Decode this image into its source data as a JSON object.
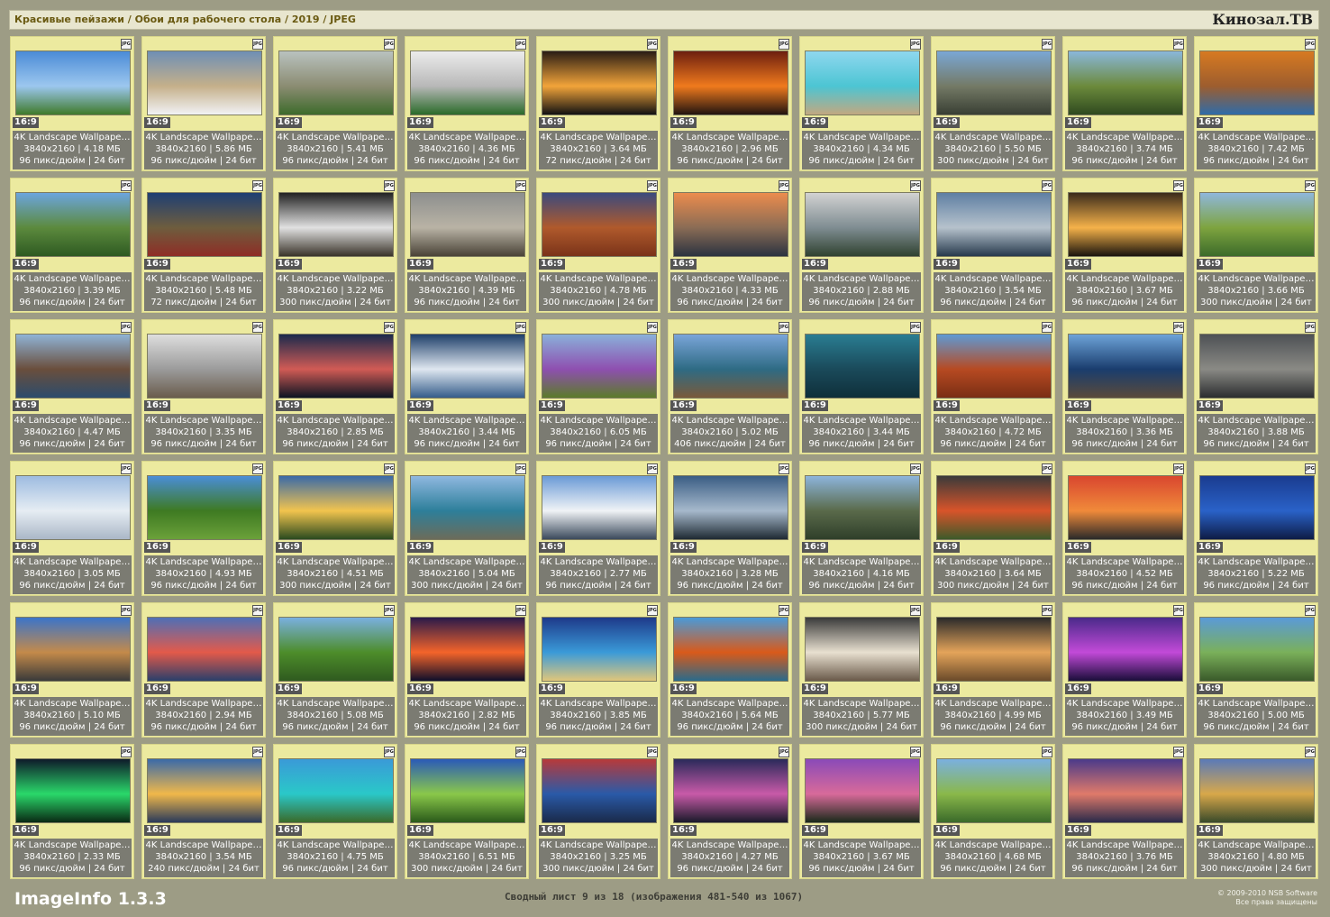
{
  "header": {
    "path": "Красивые пейзажи / Обои для рабочего стола / 2019 / JPEG",
    "brand": "Кинозал.ТВ"
  },
  "common": {
    "badge": "JPG",
    "ratio": "16:9",
    "name": "4K Landscape Wallpape…",
    "resolution": "3840x2160",
    "bit_depth": "24 бит"
  },
  "items": [
    {
      "size": "4.18 МБ",
      "dpi": "96 пикс/дюйм",
      "colors": [
        "#4b8bd6",
        "#9cc7ef",
        "#3f7a2a"
      ]
    },
    {
      "size": "5.86 МБ",
      "dpi": "96 пикс/дюйм",
      "colors": [
        "#6f8fb5",
        "#c5b08a",
        "#f1f2f5"
      ]
    },
    {
      "size": "5.41 МБ",
      "dpi": "96 пикс/дюйм",
      "colors": [
        "#b9c2bf",
        "#8b8c72",
        "#3d6b2b"
      ]
    },
    {
      "size": "4.36 МБ",
      "dpi": "96 пикс/дюйм",
      "colors": [
        "#ececec",
        "#b8b8b8",
        "#2b6b2a"
      ]
    },
    {
      "size": "3.64 МБ",
      "dpi": "72 пикс/дюйм",
      "colors": [
        "#2a1d14",
        "#f2a43a",
        "#121212"
      ]
    },
    {
      "size": "2.96 МБ",
      "dpi": "96 пикс/дюйм",
      "colors": [
        "#6d1f0f",
        "#f07a1d",
        "#211410"
      ]
    },
    {
      "size": "4.34 МБ",
      "dpi": "96 пикс/дюйм",
      "colors": [
        "#8fd7ef",
        "#4cc5d3",
        "#c2a880"
      ]
    },
    {
      "size": "5.50 МБ",
      "dpi": "300 пикс/дюйм",
      "colors": [
        "#7aa7d5",
        "#747a66",
        "#393f34"
      ]
    },
    {
      "size": "3.74 МБ",
      "dpi": "96 пикс/дюйм",
      "colors": [
        "#8ab7da",
        "#6c8a3c",
        "#2f4a1f"
      ]
    },
    {
      "size": "7.42 МБ",
      "dpi": "96 пикс/дюйм",
      "colors": [
        "#d77a21",
        "#9d5d2e",
        "#2f6ba8"
      ]
    },
    {
      "size": "3.39 МБ",
      "dpi": "96 пикс/дюйм",
      "colors": [
        "#6ca5de",
        "#5c8a3d",
        "#2e5a22"
      ]
    },
    {
      "size": "5.48 МБ",
      "dpi": "72 пикс/дюйм",
      "colors": [
        "#1f3f73",
        "#6e5d3e",
        "#8f2d26"
      ]
    },
    {
      "size": "3.22 МБ",
      "dpi": "300 пикс/дюйм",
      "colors": [
        "#222222",
        "#e1e1e1",
        "#3a342a"
      ]
    },
    {
      "size": "4.39 МБ",
      "dpi": "96 пикс/дюйм",
      "colors": [
        "#8d8f8e",
        "#b9b3a5",
        "#4a4337"
      ]
    },
    {
      "size": "4.78 МБ",
      "dpi": "300 пикс/дюйм",
      "colors": [
        "#3b4a7d",
        "#b05a2c",
        "#7a3319"
      ]
    },
    {
      "size": "4.33 МБ",
      "dpi": "96 пикс/дюйм",
      "colors": [
        "#ec8c4d",
        "#8a6c55",
        "#2b3340"
      ]
    },
    {
      "size": "2.88 МБ",
      "dpi": "96 пикс/дюйм",
      "colors": [
        "#d2d2d2",
        "#7f8d92",
        "#304230"
      ]
    },
    {
      "size": "3.54 МБ",
      "dpi": "96 пикс/дюйм",
      "colors": [
        "#5f7fa3",
        "#b6c2cc",
        "#273a4d"
      ]
    },
    {
      "size": "3.67 МБ",
      "dpi": "96 пикс/дюйм",
      "colors": [
        "#3b2b1b",
        "#f5b24a",
        "#1a140d"
      ]
    },
    {
      "size": "3.66 МБ",
      "dpi": "300 пикс/дюйм",
      "colors": [
        "#8fb7dc",
        "#7ea43f",
        "#3c6b2a"
      ]
    },
    {
      "size": "4.47 МБ",
      "dpi": "96 пикс/дюйм",
      "colors": [
        "#8fb3d6",
        "#6a4e3c",
        "#2c4c6c"
      ]
    },
    {
      "size": "3.35 МБ",
      "dpi": "96 пикс/дюйм",
      "colors": [
        "#dedede",
        "#9b9b9b",
        "#6a5c4c"
      ]
    },
    {
      "size": "2.85 МБ",
      "dpi": "96 пикс/дюйм",
      "colors": [
        "#1b2a4c",
        "#d15b55",
        "#0c1422"
      ]
    },
    {
      "size": "3.44 МБ",
      "dpi": "96 пикс/дюйм",
      "colors": [
        "#1e3f6a",
        "#dfe7f0",
        "#355d8a"
      ]
    },
    {
      "size": "6.05 МБ",
      "dpi": "96 пикс/дюйм",
      "colors": [
        "#8ab0da",
        "#8e4fb0",
        "#5b7b2a"
      ]
    },
    {
      "size": "5.02 МБ",
      "dpi": "406 пикс/дюйм",
      "colors": [
        "#7aa5d9",
        "#2e6b84",
        "#7a5a3a"
      ]
    },
    {
      "size": "3.44 МБ",
      "dpi": "96 пикс/дюйм",
      "colors": [
        "#2a7d92",
        "#1a4a5a",
        "#0f2f3a"
      ]
    },
    {
      "size": "4.72 МБ",
      "dpi": "96 пикс/дюйм",
      "colors": [
        "#5f9ad4",
        "#b74a22",
        "#7a2e14"
      ]
    },
    {
      "size": "3.36 МБ",
      "dpi": "96 пикс/дюйм",
      "colors": [
        "#6da3d8",
        "#1a3d6e",
        "#5a4a3a"
      ]
    },
    {
      "size": "3.88 МБ",
      "dpi": "96 пикс/дюйм",
      "colors": [
        "#4e5155",
        "#8a8a85",
        "#2b2d2f"
      ]
    },
    {
      "size": "3.05 МБ",
      "dpi": "96 пикс/дюйм",
      "colors": [
        "#9dbbe0",
        "#e6edf3",
        "#aab7c7"
      ]
    },
    {
      "size": "4.93 МБ",
      "dpi": "96 пикс/дюйм",
      "colors": [
        "#4a8ed8",
        "#3e7a22",
        "#6ba13a"
      ]
    },
    {
      "size": "4.51 МБ",
      "dpi": "300 пикс/дюйм",
      "colors": [
        "#3a6aa7",
        "#f2c44e",
        "#2a4a1f"
      ]
    },
    {
      "size": "5.04 МБ",
      "dpi": "300 пикс/дюйм",
      "colors": [
        "#8fb8e0",
        "#2d7f9a",
        "#6c6c5a"
      ]
    },
    {
      "size": "2.77 МБ",
      "dpi": "96 пикс/дюйм",
      "colors": [
        "#6a9ad6",
        "#f0f3f6",
        "#3b4a5c"
      ]
    },
    {
      "size": "3.28 МБ",
      "dpi": "96 пикс/дюйм",
      "colors": [
        "#3a5d84",
        "#a6b9cc",
        "#1f2a33"
      ]
    },
    {
      "size": "4.16 МБ",
      "dpi": "96 пикс/дюйм",
      "colors": [
        "#8db5dc",
        "#5a6a4a",
        "#2f3f2a"
      ]
    },
    {
      "size": "3.64 МБ",
      "dpi": "300 пикс/дюйм",
      "colors": [
        "#3a3a3a",
        "#d8542a",
        "#3d5a2a"
      ]
    },
    {
      "size": "4.52 МБ",
      "dpi": "96 пикс/дюйм",
      "colors": [
        "#d9462f",
        "#f08a3a",
        "#2a2a2a"
      ]
    },
    {
      "size": "5.22 МБ",
      "dpi": "96 пикс/дюйм",
      "colors": [
        "#1a3b8f",
        "#2a62c8",
        "#0e1c46"
      ]
    },
    {
      "size": "5.10 МБ",
      "dpi": "96 пикс/дюйм",
      "colors": [
        "#3b74c9",
        "#c48a4a",
        "#3a3a3a"
      ]
    },
    {
      "size": "2.94 МБ",
      "dpi": "96 пикс/дюйм",
      "colors": [
        "#4e6fb6",
        "#e35a4a",
        "#2a3f6a"
      ]
    },
    {
      "size": "5.08 МБ",
      "dpi": "96 пикс/дюйм",
      "colors": [
        "#7ab0e0",
        "#4d8d2a",
        "#2f5a1f"
      ]
    },
    {
      "size": "2.82 МБ",
      "dpi": "96 пикс/дюйм",
      "colors": [
        "#2a1a4a",
        "#f4642a",
        "#0e0e2a"
      ]
    },
    {
      "size": "3.85 МБ",
      "dpi": "96 пикс/дюйм",
      "colors": [
        "#1e3a8a",
        "#3a9ad8",
        "#e0c67a"
      ]
    },
    {
      "size": "5.64 МБ",
      "dpi": "96 пикс/дюйм",
      "colors": [
        "#4a9ad8",
        "#d95a1a",
        "#2a6a8a"
      ]
    },
    {
      "size": "5.77 МБ",
      "dpi": "300 пикс/дюйм",
      "colors": [
        "#3a3a3a",
        "#e8e0d0",
        "#6a5a4a"
      ]
    },
    {
      "size": "4.99 МБ",
      "dpi": "96 пикс/дюйм",
      "colors": [
        "#2a2a2a",
        "#e4a45a",
        "#6a4a2a"
      ]
    },
    {
      "size": "3.49 МБ",
      "dpi": "96 пикс/дюйм",
      "colors": [
        "#4a2a8a",
        "#c24ad8",
        "#1a0e3a"
      ]
    },
    {
      "size": "5.00 МБ",
      "dpi": "96 пикс/дюйм",
      "colors": [
        "#5a9ad8",
        "#7ab05a",
        "#3a5a2a"
      ]
    },
    {
      "size": "2.33 МБ",
      "dpi": "96 пикс/дюйм",
      "colors": [
        "#0e1a2a",
        "#2ad86a",
        "#0a2a14"
      ]
    },
    {
      "size": "3.54 МБ",
      "dpi": "240 пикс/дюйм",
      "colors": [
        "#3a6aa8",
        "#f0b84a",
        "#2a3a5a"
      ]
    },
    {
      "size": "4.75 МБ",
      "dpi": "96 пикс/дюйм",
      "colors": [
        "#3a9ad8",
        "#2ac8c8",
        "#3a6a2a"
      ]
    },
    {
      "size": "6.51 МБ",
      "dpi": "300 пикс/дюйм",
      "colors": [
        "#2a5ab8",
        "#8ac84a",
        "#2a5a1a"
      ]
    },
    {
      "size": "3.25 МБ",
      "dpi": "300 пикс/дюйм",
      "colors": [
        "#b83a3a",
        "#2a5aa8",
        "#1a2a4a"
      ]
    },
    {
      "size": "4.27 МБ",
      "dpi": "96 пикс/дюйм",
      "colors": [
        "#2a2a5a",
        "#c85aa8",
        "#1a1a2a"
      ]
    },
    {
      "size": "3.67 МБ",
      "dpi": "96 пикс/дюйм",
      "colors": [
        "#8a4ab8",
        "#d86a9a",
        "#1a2a1a"
      ]
    },
    {
      "size": "4.68 МБ",
      "dpi": "96 пикс/дюйм",
      "colors": [
        "#7ab0e0",
        "#8ab84a",
        "#3a6a2a"
      ]
    },
    {
      "size": "3.76 МБ",
      "dpi": "96 пикс/дюйм",
      "colors": [
        "#4a3a8a",
        "#e07a6a",
        "#2a2a4a"
      ]
    },
    {
      "size": "4.80 МБ",
      "dpi": "300 пикс/дюйм",
      "colors": [
        "#5a7ab8",
        "#d8a84a",
        "#3a4a2a"
      ]
    }
  ],
  "footer": {
    "app": "ImageInfo 1.3.3",
    "summary": "Сводный лист 9 из 18 (изображения 481-540 из 1067)",
    "copyright": "© 2009-2010 NSB Software",
    "rights": "Все права защищены"
  }
}
